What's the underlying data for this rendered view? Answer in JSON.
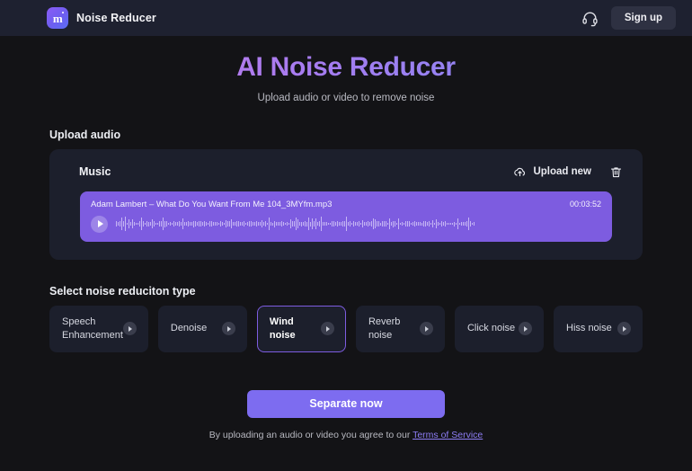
{
  "header": {
    "brand_name": "Noise Reducer",
    "logo_letter": "m",
    "support_icon": "headset-icon",
    "signup_label": "Sign up"
  },
  "hero": {
    "title": "AI Noise Reducer",
    "subtitle": "Upload audio or video to remove noise",
    "title_gradient_from": "#d47ae8",
    "title_gradient_to": "#7a8df5"
  },
  "upload": {
    "section_title": "Upload audio",
    "card_label": "Music",
    "upload_new_label": "Upload new",
    "upload_icon": "cloud-upload-icon",
    "delete_icon": "trash-icon",
    "track": {
      "filename": "Adam Lambert – What Do You Want From Me 104_3MYfm.mp3",
      "duration": "00:03:52",
      "play_icon": "play-icon",
      "accent_color": "#7d5ce0"
    }
  },
  "noise_types": {
    "section_title": "Select noise reduciton type",
    "selected": "Wind noise",
    "items": [
      {
        "label": "Speech Enhancement",
        "selected": false,
        "play_icon": "play-icon"
      },
      {
        "label": "Denoise",
        "selected": false,
        "play_icon": "play-icon"
      },
      {
        "label": "Wind noise",
        "selected": true,
        "play_icon": "play-icon"
      },
      {
        "label": "Reverb noise",
        "selected": false,
        "play_icon": "play-icon"
      },
      {
        "label": "Click noise",
        "selected": false,
        "play_icon": "play-icon"
      },
      {
        "label": "Hiss noise",
        "selected": false,
        "play_icon": "play-icon"
      }
    ]
  },
  "footer": {
    "cta_label": "Separate now",
    "terms_prefix": "By uploading an audio or video you agree to our ",
    "terms_link": "Terms of Service"
  }
}
